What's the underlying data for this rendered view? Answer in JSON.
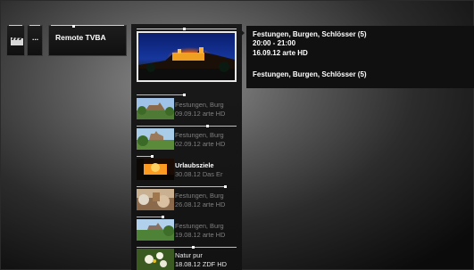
{
  "tiles": [
    {
      "label": "",
      "icon": "clapperboard-icon"
    },
    {
      "label": "..."
    },
    {
      "label": "Remote TVBA"
    }
  ],
  "selected": {
    "title": "Festungen, Burgen, Schlösser (5)",
    "time": "20:00 - 21:00",
    "date_channel": "16.09.12  arte HD",
    "subtitle": "Festungen, Burgen, Schlösser (5)"
  },
  "recordings": [
    {
      "title": "Festungen, Burg",
      "meta": "09.09.12 arte HD",
      "style": "dim"
    },
    {
      "title": "Festungen, Burg",
      "meta": "02.09.12 arte HD",
      "style": "dim"
    },
    {
      "title": "Urlaubsziele",
      "meta": "30.08.12 Das Er",
      "style": "bright"
    },
    {
      "title": "Festungen, Burg",
      "meta": "26.08.12 arte HD",
      "style": "dim"
    },
    {
      "title": "Festungen, Burg",
      "meta": "19.08.12 arte HD",
      "style": "dim"
    },
    {
      "title": "Natur pur",
      "meta": "18.08.12 ZDF HD",
      "style": "bright2"
    }
  ]
}
